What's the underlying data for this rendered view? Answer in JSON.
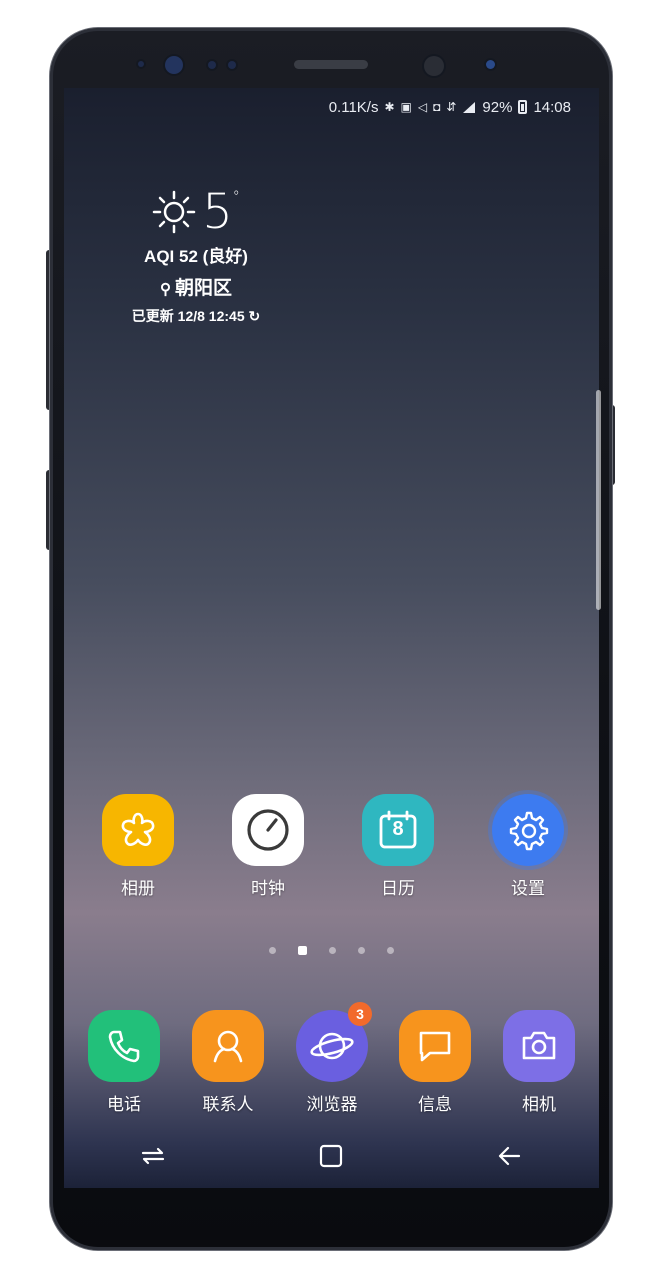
{
  "status_bar": {
    "speed": "0.11K/s",
    "battery": "92%",
    "time": "14:08"
  },
  "weather": {
    "temperature": "5",
    "degree_symbol": "°",
    "aqi": "AQI 52 (良好)",
    "location": "朝阳区",
    "updated": "已更新 12/8 12:45"
  },
  "apps": [
    {
      "label": "相册",
      "color": "#f7b600"
    },
    {
      "label": "时钟",
      "color": "#ffffff"
    },
    {
      "label": "日历",
      "color": "#2fb7c0",
      "date": "8"
    },
    {
      "label": "设置",
      "color": "#3d7bf0"
    }
  ],
  "dock": [
    {
      "label": "电话",
      "color": "#22c07a"
    },
    {
      "label": "联系人",
      "color": "#f7941d"
    },
    {
      "label": "浏览器",
      "color": "#6a5fe0",
      "badge": "3"
    },
    {
      "label": "信息",
      "color": "#f7941d"
    },
    {
      "label": "相机",
      "color": "#7d6fe6"
    }
  ],
  "pager": {
    "pages": 5,
    "current": 2
  }
}
